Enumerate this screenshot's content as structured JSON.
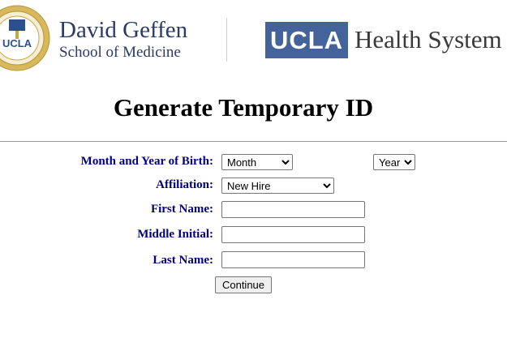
{
  "header": {
    "seal_text": "UCLA",
    "school_line1": "David Geffen",
    "school_line2": "School of Medicine",
    "ucla_logo_text": "UCLA",
    "health_system_text": "Health System"
  },
  "page": {
    "title": "Generate Temporary ID"
  },
  "form": {
    "birth": {
      "label": "Month and Year of Birth:",
      "month_value": "Month",
      "year_value": "Year"
    },
    "affiliation": {
      "label": "Affiliation:",
      "value": "New Hire"
    },
    "first_name": {
      "label": "First Name:",
      "value": ""
    },
    "middle_initial": {
      "label": "Middle Initial:",
      "value": ""
    },
    "last_name": {
      "label": "Last Name:",
      "value": ""
    },
    "submit_label": "Continue"
  },
  "colors": {
    "label_navy": "#000080",
    "ucla_blue": "#44639a",
    "seal_gold": "#c9a646"
  }
}
